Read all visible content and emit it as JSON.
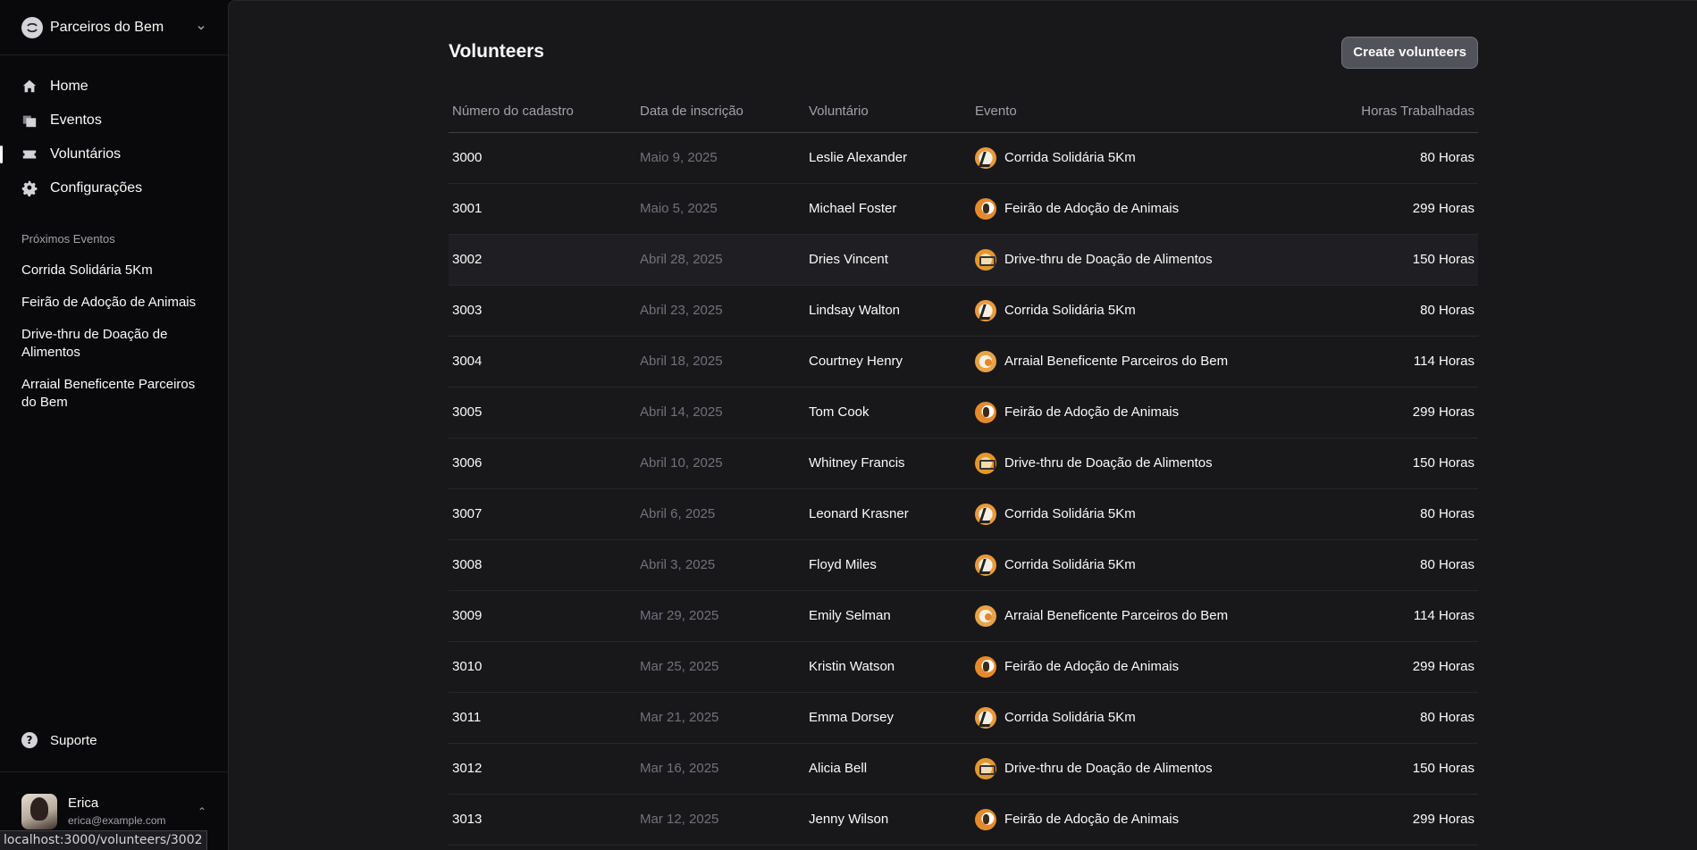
{
  "team": {
    "name": "Parceiros do Bem"
  },
  "nav": [
    {
      "label": "Home",
      "icon": "home-icon"
    },
    {
      "label": "Eventos",
      "icon": "square-stack-icon"
    },
    {
      "label": "Voluntários",
      "icon": "ticket-icon",
      "active": true
    },
    {
      "label": "Configurações",
      "icon": "gear-icon"
    }
  ],
  "upcoming": {
    "heading": "Próximos Eventos",
    "items": [
      "Corrida Solidária 5Km",
      "Feirão de Adoção de Animais",
      "Drive-thru de Doação de Alimentos",
      "Arraial Beneficente Parceiros do Bem"
    ]
  },
  "support": {
    "label": "Suporte"
  },
  "user": {
    "name": "Erica",
    "email": "erica@example.com"
  },
  "status_url": "localhost:3000/volunteers/3002",
  "page": {
    "title": "Volunteers",
    "create_label": "Create volunteers"
  },
  "table": {
    "headers": [
      "Número do cadastro",
      "Data de inscrição",
      "Voluntário",
      "Evento",
      "Horas Trabalhadas"
    ],
    "rows": [
      {
        "id": "3000",
        "date": "Maio 9, 2025",
        "name": "Leslie Alexander",
        "event": "Corrida Solidária 5Km",
        "event_icon": "run",
        "hours": "80 Horas"
      },
      {
        "id": "3001",
        "date": "Maio 5, 2025",
        "name": "Michael Foster",
        "event": "Feirão de Adoção de Animais",
        "event_icon": "adopt",
        "hours": "299 Horas"
      },
      {
        "id": "3002",
        "date": "Abril 28, 2025",
        "name": "Dries Vincent",
        "event": "Drive-thru de Doação de Alimentos",
        "event_icon": "food",
        "hours": "150 Horas"
      },
      {
        "id": "3003",
        "date": "Abril 23, 2025",
        "name": "Lindsay Walton",
        "event": "Corrida Solidária 5Km",
        "event_icon": "run",
        "hours": "80 Horas"
      },
      {
        "id": "3004",
        "date": "Abril 18, 2025",
        "name": "Courtney Henry",
        "event": "Arraial Beneficente Parceiros do Bem",
        "event_icon": "arraial",
        "hours": "114 Horas"
      },
      {
        "id": "3005",
        "date": "Abril 14, 2025",
        "name": "Tom Cook",
        "event": "Feirão de Adoção de Animais",
        "event_icon": "adopt",
        "hours": "299 Horas"
      },
      {
        "id": "3006",
        "date": "Abril 10, 2025",
        "name": "Whitney Francis",
        "event": "Drive-thru de Doação de Alimentos",
        "event_icon": "food",
        "hours": "150 Horas"
      },
      {
        "id": "3007",
        "date": "Abril 6, 2025",
        "name": "Leonard Krasner",
        "event": "Corrida Solidária 5Km",
        "event_icon": "run",
        "hours": "80 Horas"
      },
      {
        "id": "3008",
        "date": "Abril 3, 2025",
        "name": "Floyd Miles",
        "event": "Corrida Solidária 5Km",
        "event_icon": "run",
        "hours": "80 Horas"
      },
      {
        "id": "3009",
        "date": "Mar 29, 2025",
        "name": "Emily Selman",
        "event": "Arraial Beneficente Parceiros do Bem",
        "event_icon": "arraial",
        "hours": "114 Horas"
      },
      {
        "id": "3010",
        "date": "Mar 25, 2025",
        "name": "Kristin Watson",
        "event": "Feirão de Adoção de Animais",
        "event_icon": "adopt",
        "hours": "299 Horas"
      },
      {
        "id": "3011",
        "date": "Mar 21, 2025",
        "name": "Emma Dorsey",
        "event": "Corrida Solidária 5Km",
        "event_icon": "run",
        "hours": "80 Horas"
      },
      {
        "id": "3012",
        "date": "Mar 16, 2025",
        "name": "Alicia Bell",
        "event": "Drive-thru de Doação de Alimentos",
        "event_icon": "food",
        "hours": "150 Horas"
      },
      {
        "id": "3013",
        "date": "Mar 12, 2025",
        "name": "Jenny Wilson",
        "event": "Feirão de Adoção de Animais",
        "event_icon": "adopt",
        "hours": "299 Horas"
      }
    ],
    "hovered_id": "3002"
  }
}
